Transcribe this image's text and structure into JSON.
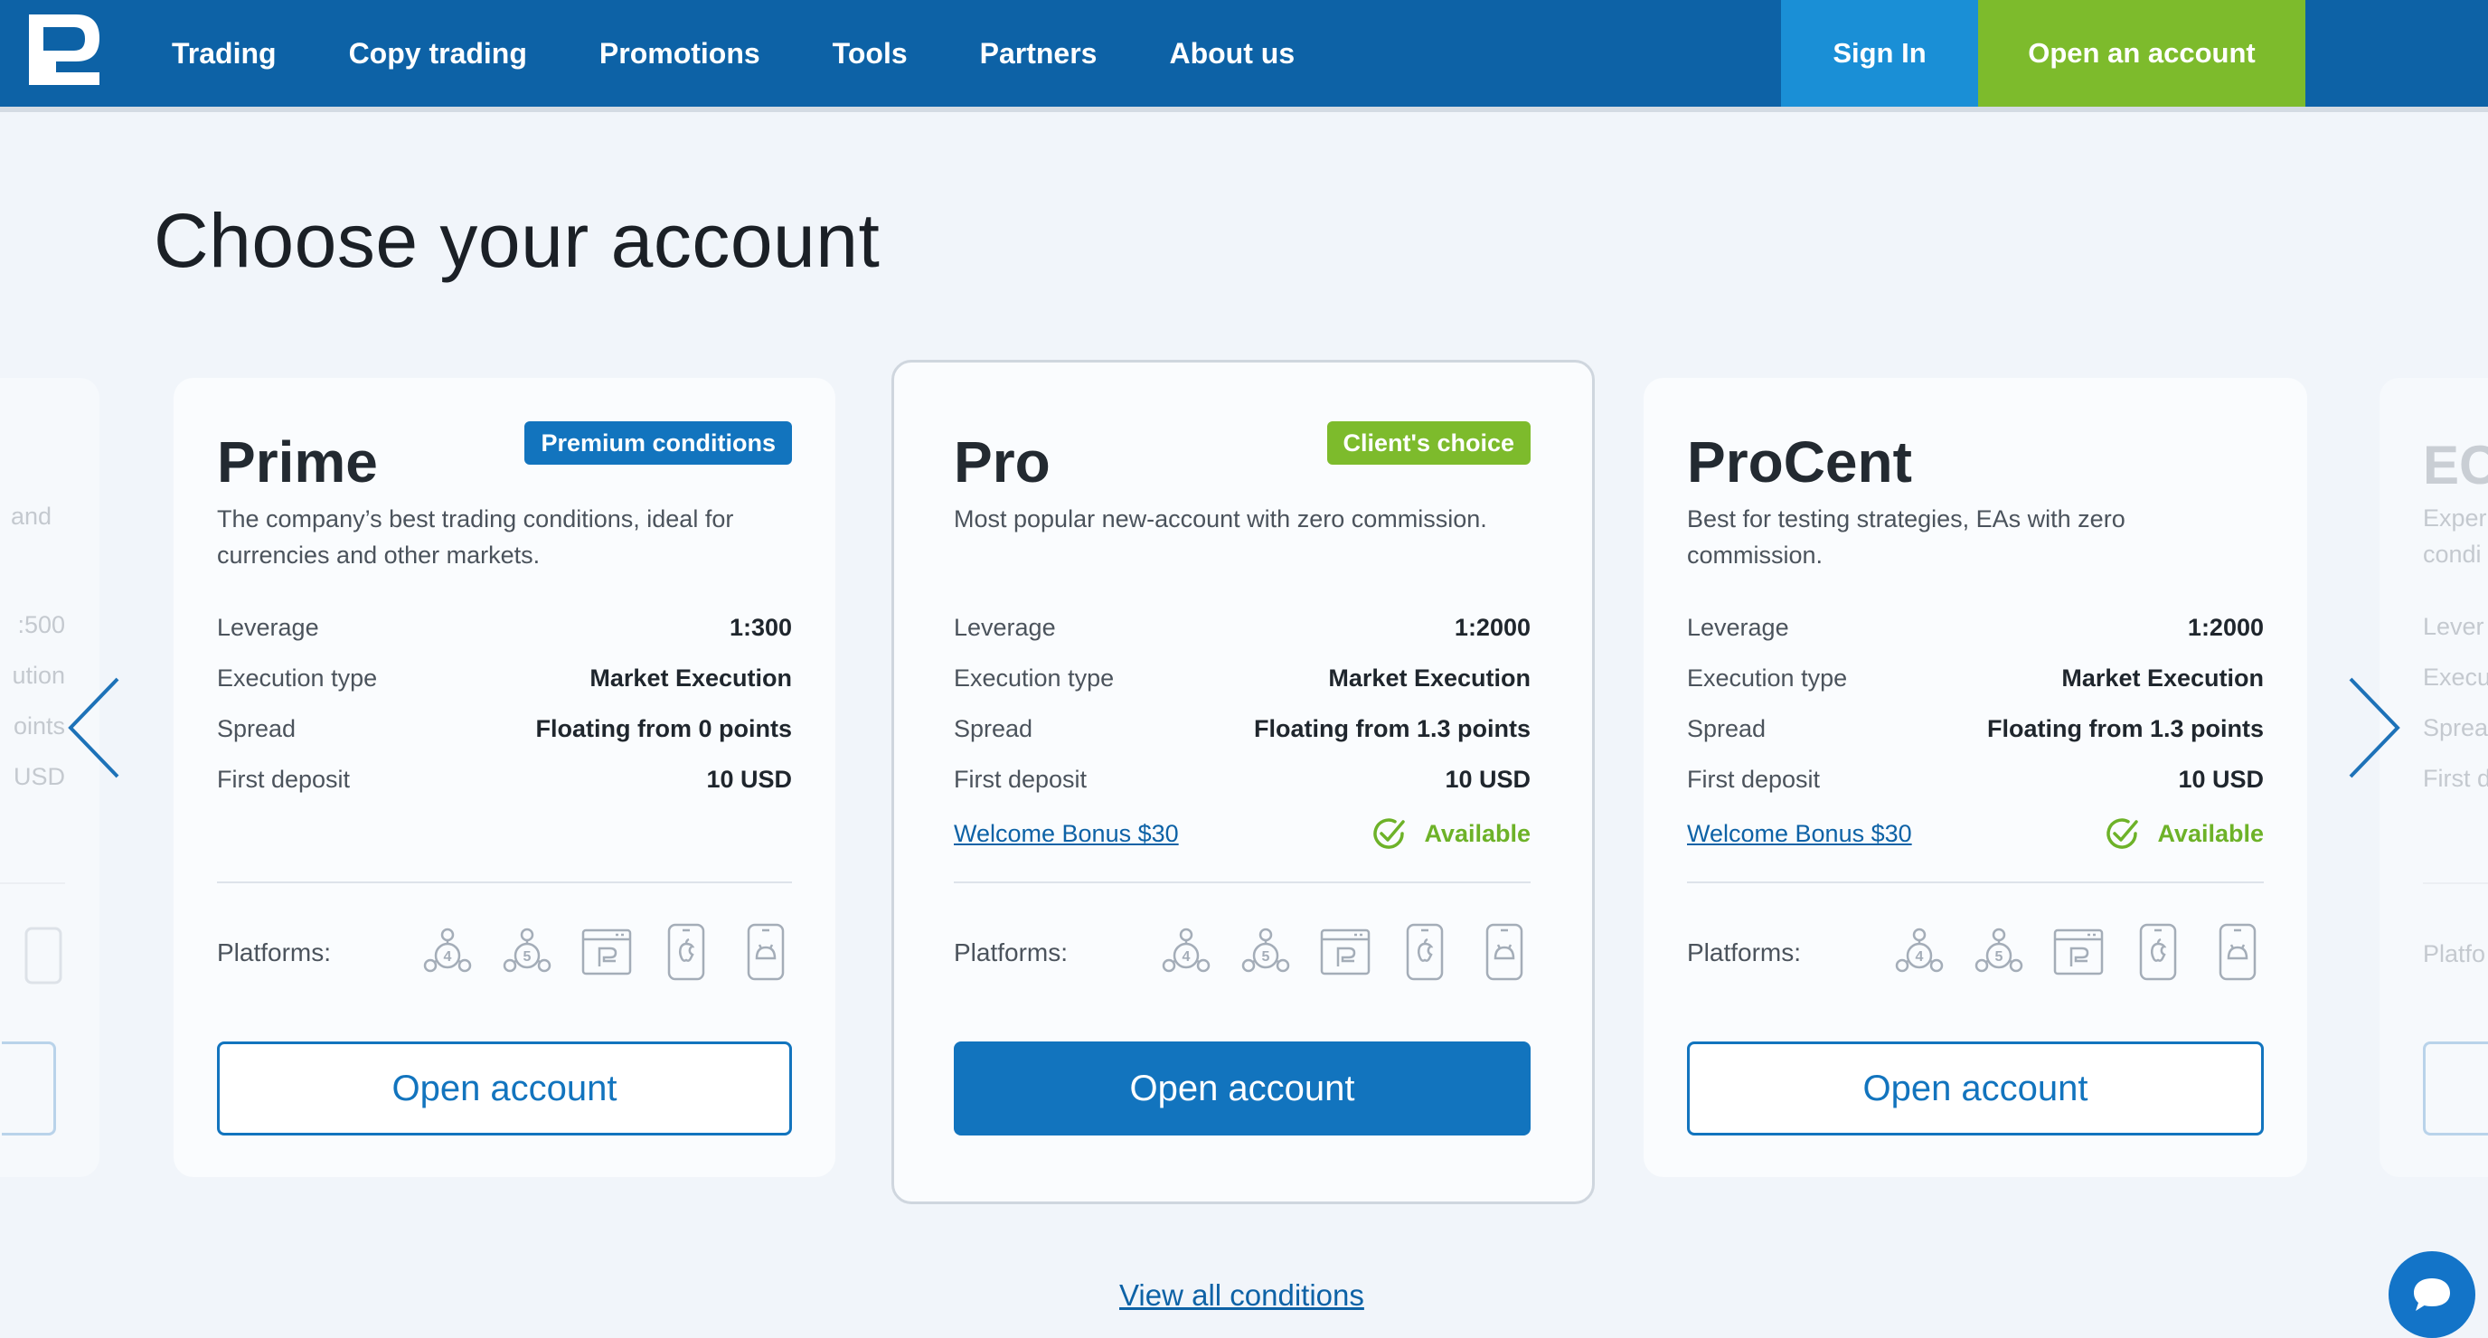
{
  "header": {
    "nav": [
      "Trading",
      "Copy trading",
      "Promotions",
      "Tools",
      "Partners",
      "About us"
    ],
    "sign_in": "Sign In",
    "open_account": "Open an account"
  },
  "page_title": "Choose your account",
  "left_partial_card": {
    "desc_fragment": "and",
    "values": [
      ":500",
      "ution",
      "oints",
      "USD"
    ]
  },
  "cards": [
    {
      "name": "Prime",
      "badge": "Premium conditions",
      "badge_color": "#1274be",
      "desc_line1": "The company’s best trading conditions, ideal for",
      "desc_line2": "currencies and other markets.",
      "rows": [
        {
          "label": "Leverage",
          "value": "1:300"
        },
        {
          "label": "Execution type",
          "value": "Market Execution"
        },
        {
          "label": "Spread",
          "value": "Floating from 0 points"
        },
        {
          "label": "First deposit",
          "value": "10 USD"
        }
      ],
      "platforms_label": "Platforms:",
      "button": "Open account"
    },
    {
      "name": "Pro",
      "badge": "Client's choice",
      "badge_color": "#7dbb2c",
      "desc_line1": "Most popular new-account with zero commission.",
      "desc_line2": "",
      "rows": [
        {
          "label": "Leverage",
          "value": "1:2000"
        },
        {
          "label": "Execution type",
          "value": "Market Execution"
        },
        {
          "label": "Spread",
          "value": "Floating from 1.3 points"
        },
        {
          "label": "First deposit",
          "value": "10 USD"
        }
      ],
      "bonus_label": "Welcome Bonus $30",
      "bonus_status": "Available",
      "platforms_label": "Platforms:",
      "button": "Open account"
    },
    {
      "name": "ProCent",
      "badge": "",
      "desc_line1": "Best for testing strategies, EAs with zero",
      "desc_line2": "commission.",
      "rows": [
        {
          "label": "Leverage",
          "value": "1:2000"
        },
        {
          "label": "Execution type",
          "value": "Market Execution"
        },
        {
          "label": "Spread",
          "value": "Floating from 1.3 points"
        },
        {
          "label": "First deposit",
          "value": "10 USD"
        }
      ],
      "bonus_label": "Welcome Bonus $30",
      "bonus_status": "Available",
      "platforms_label": "Platforms:",
      "button": "Open account"
    }
  ],
  "right_partial_card": {
    "name": "EC",
    "desc": [
      "Exper",
      "condi"
    ],
    "labels": [
      "Lever",
      "Execu",
      "Sprea",
      "First d"
    ],
    "platforms": "Platfo"
  },
  "platform_icons": [
    "mt4-icon",
    "mt5-icon",
    "webtrader-icon",
    "ios-icon",
    "android-icon"
  ],
  "view_all": "View all conditions"
}
